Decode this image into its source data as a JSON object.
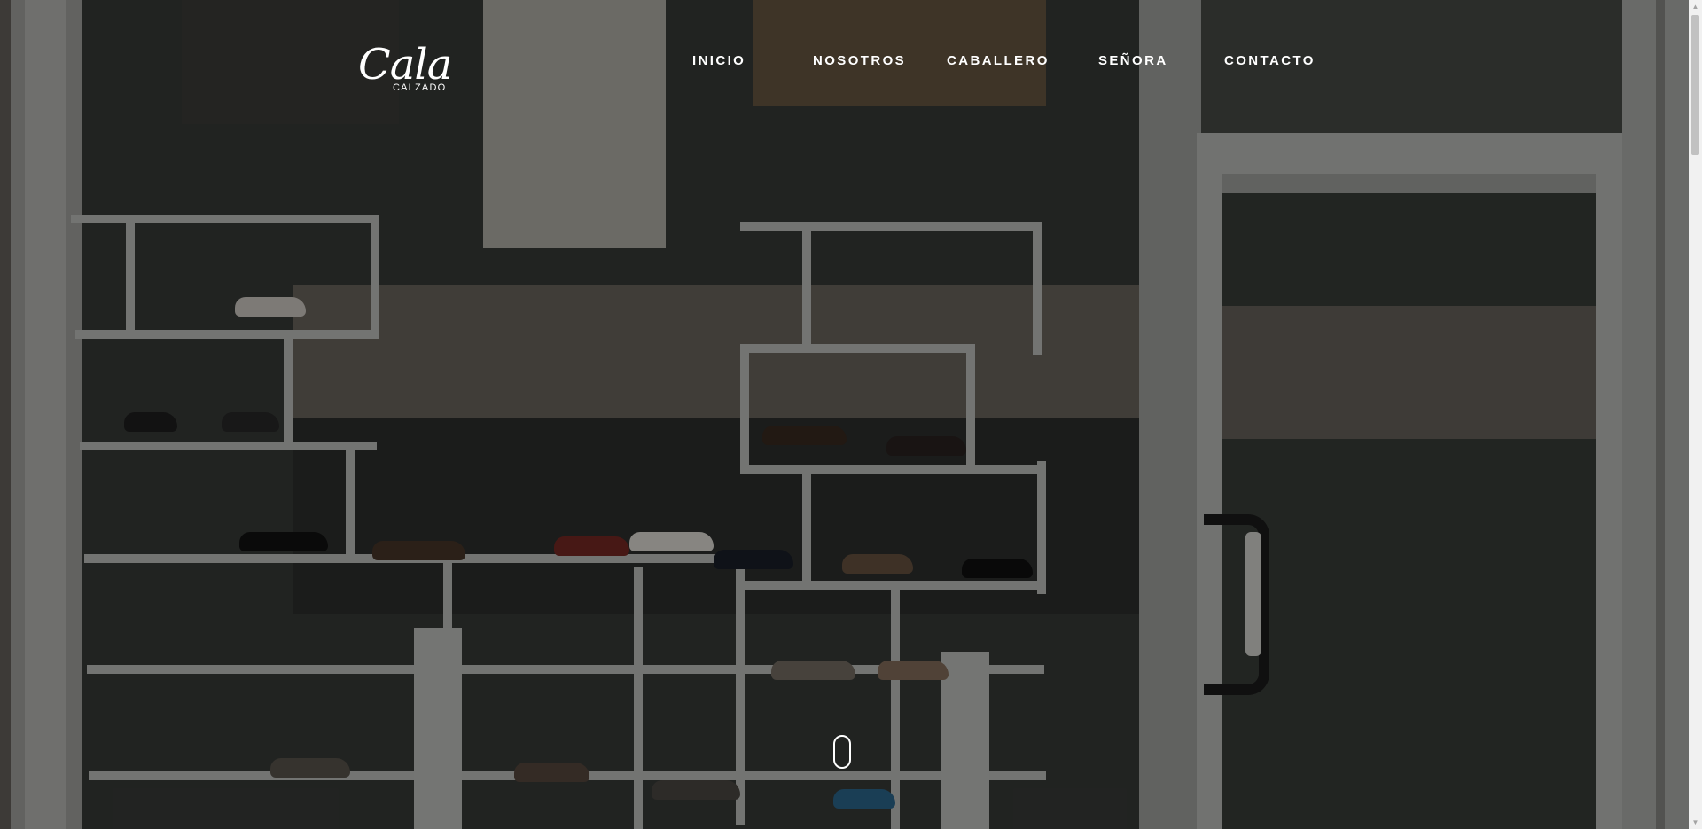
{
  "brand": {
    "logo_script": "Cala",
    "logo_sub": "CALZADO"
  },
  "nav": {
    "items": [
      {
        "label": "INICIO"
      },
      {
        "label": "NOSOTROS"
      },
      {
        "label": "CABALLERO"
      },
      {
        "label": "SEÑORA"
      },
      {
        "label": "CONTACTO"
      }
    ]
  },
  "hero": {
    "image": "shoe-store-storefront-photo",
    "overlay_color": "#000000"
  },
  "scroll_indicator": {
    "icon": "mouse-scroll-icon"
  },
  "scrollbar": {
    "up_icon": "scroll-up-arrow-icon",
    "down_icon": "scroll-down-arrow-icon"
  },
  "colors": {
    "nav_text": "#ffffff",
    "scrollbar_track": "#f1f1f1",
    "scrollbar_thumb": "#c1c1c1"
  }
}
